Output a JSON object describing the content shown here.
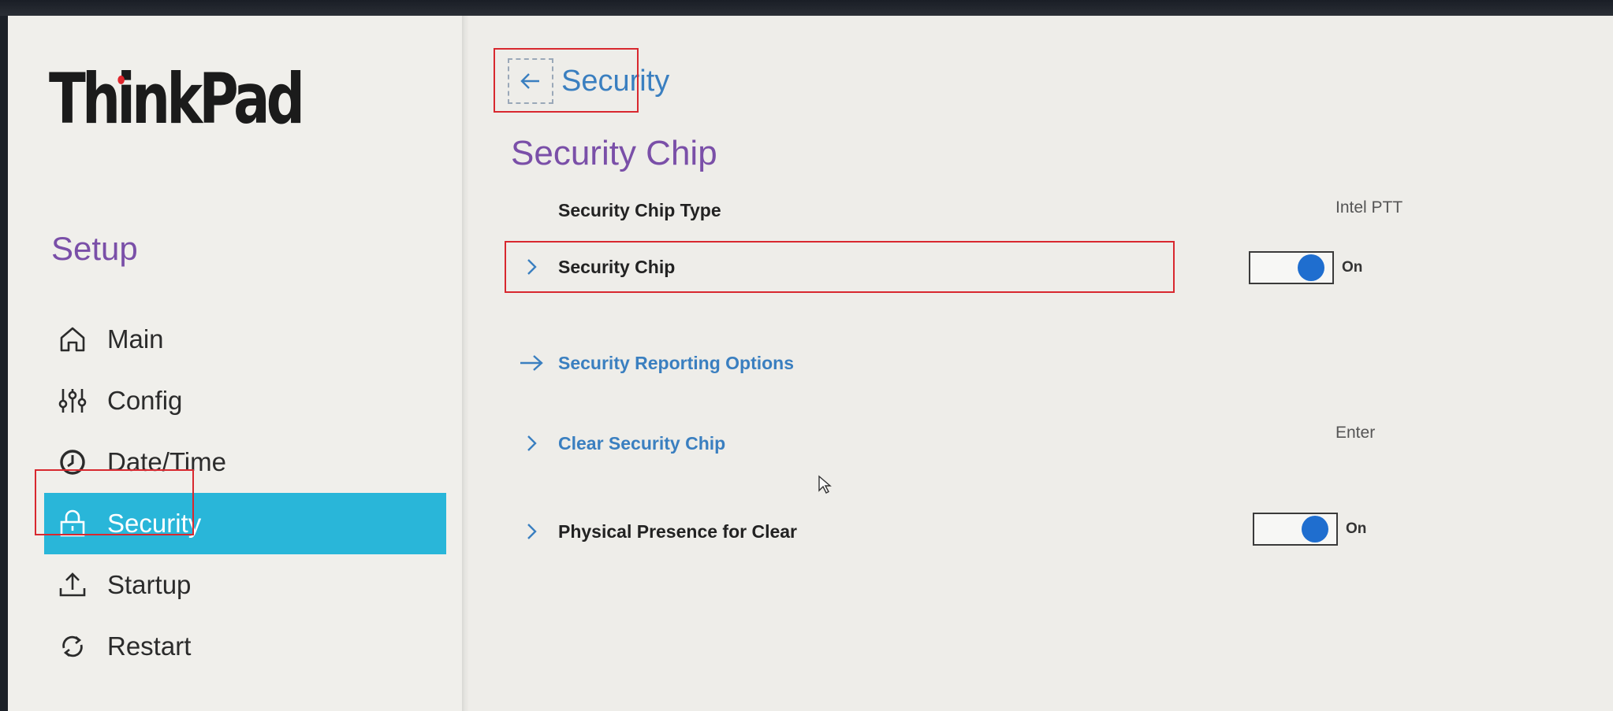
{
  "brand": {
    "logo_text": "ThinkPad"
  },
  "sidebar": {
    "title": "Setup",
    "items": [
      {
        "label": "Main",
        "icon": "home-icon"
      },
      {
        "label": "Config",
        "icon": "sliders-icon"
      },
      {
        "label": "Date/Time",
        "icon": "clock-icon"
      },
      {
        "label": "Security",
        "icon": "lock-icon",
        "active": true
      },
      {
        "label": "Startup",
        "icon": "upload-icon"
      },
      {
        "label": "Restart",
        "icon": "restart-icon"
      }
    ]
  },
  "header": {
    "back_label": "Security",
    "page_title": "Security Chip"
  },
  "settings": [
    {
      "label": "Security Chip Type",
      "value": "Intel PTT"
    },
    {
      "label": "Security Chip",
      "toggle": "On"
    },
    {
      "label": "Security Reporting Options"
    },
    {
      "label": "Clear Security Chip",
      "value": "Enter"
    },
    {
      "label": "Physical Presence for Clear",
      "toggle": "On"
    }
  ],
  "colors": {
    "accent_active": "#29b6d9",
    "title_purple": "#7a4fa8",
    "link_blue": "#3a7fc0",
    "toggle_blue": "#1f6ecf",
    "highlight_red": "#d8282f"
  }
}
